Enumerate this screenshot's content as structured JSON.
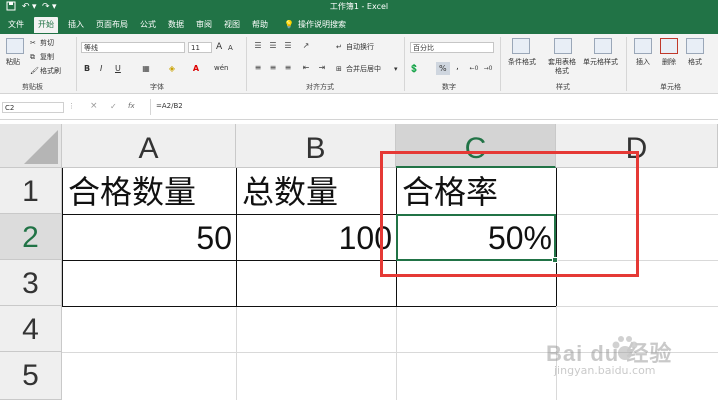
{
  "quick_access": {
    "save_icon": "save-icon",
    "undo_icon": "undo-icon",
    "redo_icon": "redo-icon"
  },
  "window_title": "工作簿1 - Excel",
  "tabs": [
    "文件",
    "开始",
    "插入",
    "页面布局",
    "公式",
    "数据",
    "审阅",
    "视图",
    "帮助"
  ],
  "tell_me": "操作说明搜索",
  "ribbon": {
    "clipboard": {
      "paste": "粘贴",
      "cut": "剪切",
      "copy": "复制",
      "format_painter": "格式刷",
      "label": "剪贴板"
    },
    "font": {
      "name": "等线",
      "size": "11",
      "label": "字体",
      "bold": "B",
      "italic": "I",
      "underline": "U",
      "grow": "A",
      "shrink": "A",
      "wen": "wén"
    },
    "alignment": {
      "wrap": "自动换行",
      "merge": "合并后居中",
      "label": "对齐方式"
    },
    "number": {
      "format": "百分比",
      "percent": "%",
      "comma": ",",
      "label": "数字"
    },
    "styles": {
      "conditional": "条件格式",
      "table": "套用表格格式",
      "cell": "单元格样式",
      "label": "样式"
    },
    "cells": {
      "insert": "插入",
      "delete": "删除",
      "format": "格式",
      "label": "单元格"
    }
  },
  "formula_bar": {
    "name_box": "C2",
    "cancel": "×",
    "enter": "✓",
    "fx": "fx",
    "formula": "=A2/B2"
  },
  "columns": [
    "A",
    "B",
    "C",
    "D"
  ],
  "rows": [
    "1",
    "2",
    "3",
    "4",
    "5"
  ],
  "cells": {
    "A1": "合格数量",
    "B1": "总数量",
    "C1": "合格率",
    "A2": "50",
    "B2": "100",
    "C2": "50%"
  },
  "selected_cell": "C2",
  "watermark": {
    "brand": "Bai du 经验",
    "url": "jingyan.baidu.com"
  },
  "highlight_color": "#e53935",
  "accent": "#217346"
}
